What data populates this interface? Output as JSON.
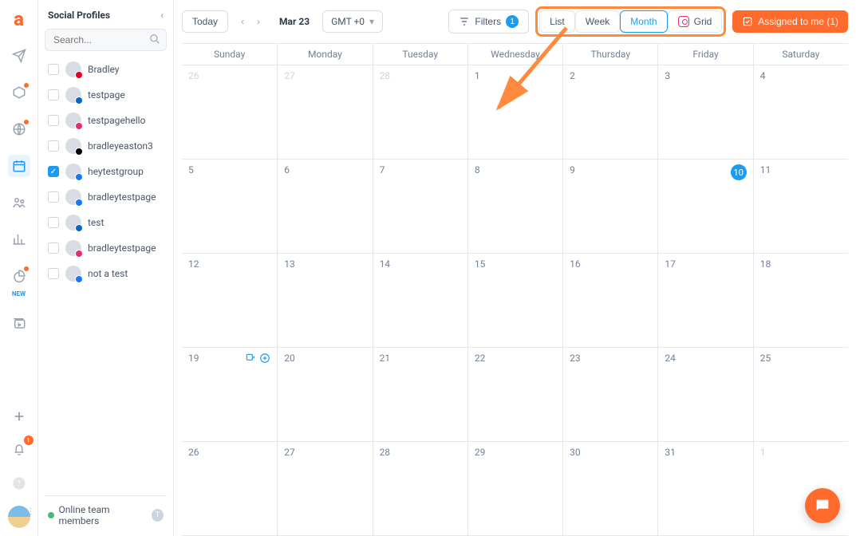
{
  "leftnav": {
    "new_label": "NEW",
    "bell_badge": "1"
  },
  "sidebar": {
    "title": "Social Profiles",
    "search_placeholder": "Search...",
    "profiles": [
      {
        "name": "Bradley",
        "checked": false,
        "badge_color": "#e60023"
      },
      {
        "name": "testpage",
        "checked": false,
        "badge_color": "#0a66c2"
      },
      {
        "name": "testpagehello",
        "checked": false,
        "badge_color": "#e1306c"
      },
      {
        "name": "bradleyeaston3",
        "checked": false,
        "badge_color": "#000000"
      },
      {
        "name": "heytestgroup",
        "checked": true,
        "badge_color": "#1877f2"
      },
      {
        "name": "bradleytestpage",
        "checked": false,
        "badge_color": "#1877f2"
      },
      {
        "name": "test",
        "checked": false,
        "badge_color": "#0a66c2"
      },
      {
        "name": "bradleytestpage",
        "checked": false,
        "badge_color": "#e1306c"
      },
      {
        "name": "not a test",
        "checked": false,
        "badge_color": "#1877f2"
      }
    ],
    "footer_label": "Online team members",
    "footer_chip": "T"
  },
  "toolbar": {
    "today": "Today",
    "date": "Mar 23",
    "gmt": "GMT +0",
    "filters_label": "Filters",
    "filters_count": "1",
    "views": {
      "list": "List",
      "week": "Week",
      "month": "Month",
      "grid": "Grid"
    },
    "assigned": "Assigned to me (1)"
  },
  "calendar": {
    "weekdays": [
      "Sunday",
      "Monday",
      "Tuesday",
      "Wednesday",
      "Thursday",
      "Friday",
      "Saturday"
    ],
    "rows": [
      [
        {
          "n": "26",
          "muted": true
        },
        {
          "n": "27",
          "muted": true
        },
        {
          "n": "28",
          "muted": true
        },
        {
          "n": "1"
        },
        {
          "n": "2"
        },
        {
          "n": "3"
        },
        {
          "n": "4"
        }
      ],
      [
        {
          "n": "5"
        },
        {
          "n": "6"
        },
        {
          "n": "7"
        },
        {
          "n": "8"
        },
        {
          "n": "9"
        },
        {
          "n": "10",
          "pill": true
        },
        {
          "n": "11"
        }
      ],
      [
        {
          "n": "12"
        },
        {
          "n": "13"
        },
        {
          "n": "14"
        },
        {
          "n": "15"
        },
        {
          "n": "16"
        },
        {
          "n": "17"
        },
        {
          "n": "18"
        }
      ],
      [
        {
          "n": "19",
          "icons": true
        },
        {
          "n": "20"
        },
        {
          "n": "21"
        },
        {
          "n": "22"
        },
        {
          "n": "23"
        },
        {
          "n": "24"
        },
        {
          "n": "25"
        }
      ],
      [
        {
          "n": "26"
        },
        {
          "n": "27"
        },
        {
          "n": "28"
        },
        {
          "n": "29"
        },
        {
          "n": "30"
        },
        {
          "n": "31"
        },
        {
          "n": "1",
          "muted": true
        }
      ]
    ]
  },
  "colors": {
    "accent": "#ff6b2c",
    "primary": "#1d9bf0"
  }
}
